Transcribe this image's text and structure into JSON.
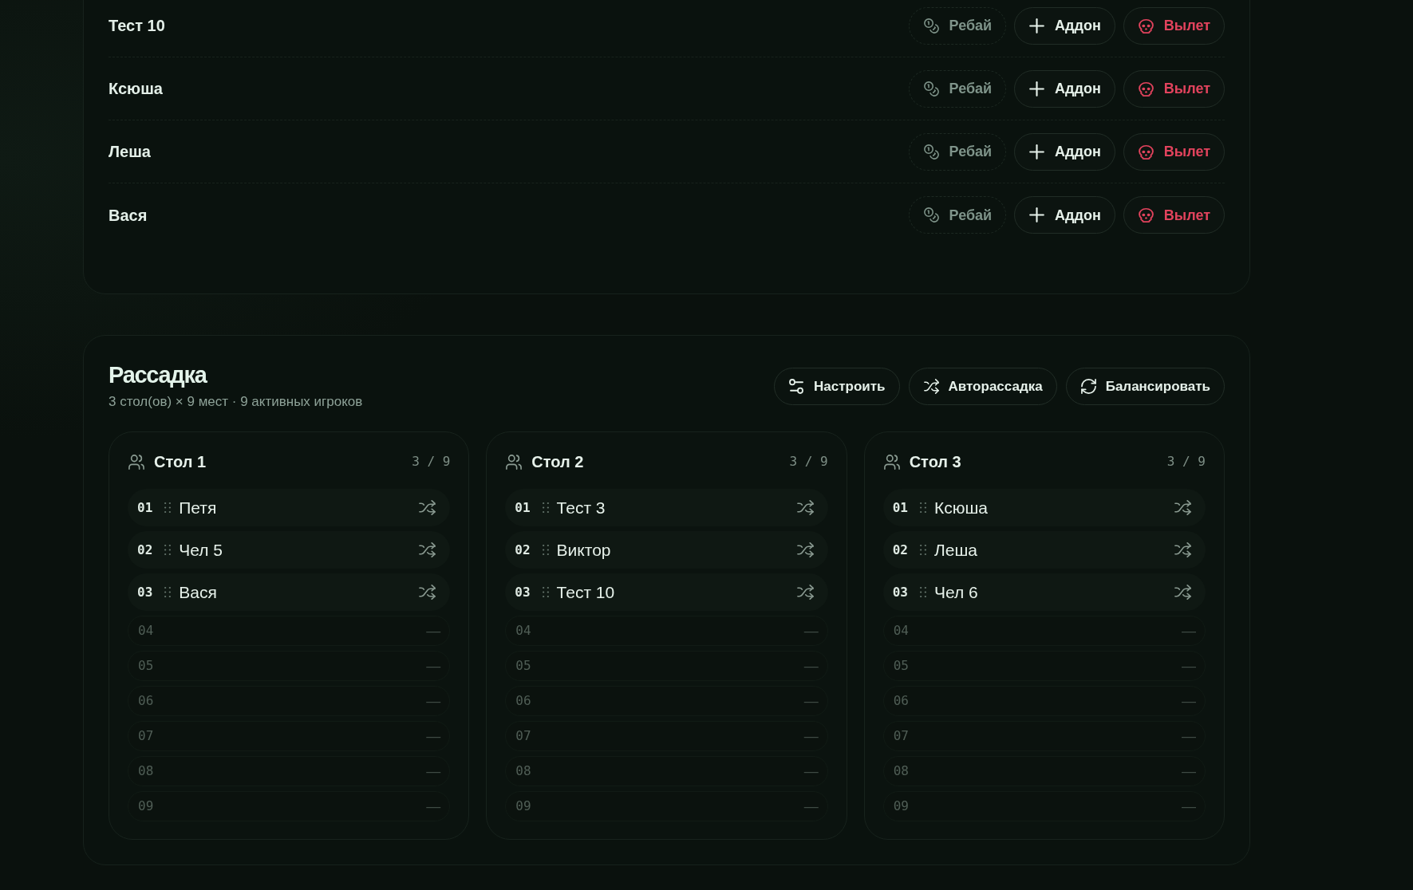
{
  "players": [
    {
      "name": "Тест 10",
      "actions": [
        {
          "label": "Ребай",
          "kind": "rebuy",
          "disabled": true
        },
        {
          "label": "Аддон",
          "kind": "addon",
          "disabled": false
        },
        {
          "label": "Вылет",
          "kind": "bust",
          "disabled": false
        }
      ]
    },
    {
      "name": "Ксюша",
      "actions": [
        {
          "label": "Ребай",
          "kind": "rebuy",
          "disabled": true
        },
        {
          "label": "Аддон",
          "kind": "addon",
          "disabled": false
        },
        {
          "label": "Вылет",
          "kind": "bust",
          "disabled": false
        }
      ]
    },
    {
      "name": "Леша",
      "actions": [
        {
          "label": "Ребай",
          "kind": "rebuy",
          "disabled": true
        },
        {
          "label": "Аддон",
          "kind": "addon",
          "disabled": false
        },
        {
          "label": "Вылет",
          "kind": "bust",
          "disabled": false
        }
      ]
    },
    {
      "name": "Вася",
      "actions": [
        {
          "label": "Ребай",
          "kind": "rebuy",
          "disabled": true
        },
        {
          "label": "Аддон",
          "kind": "addon",
          "disabled": false
        },
        {
          "label": "Вылет",
          "kind": "bust",
          "disabled": false
        }
      ]
    }
  ],
  "seating": {
    "title": "Рассадка",
    "subtitle": "3 стол(ов) × 9 мест · 9 активных игроков",
    "buttons": [
      {
        "label": "Настроить",
        "kind": "configure"
      },
      {
        "label": "Авторассадка",
        "kind": "autoseat"
      },
      {
        "label": "Балансировать",
        "kind": "balance"
      }
    ],
    "tables": [
      {
        "name": "Стол 1",
        "count": "3 / 9",
        "seats": [
          {
            "number": "01",
            "kind": "player",
            "name": "Петя"
          },
          {
            "number": "02",
            "kind": "player",
            "name": "Чел 5"
          },
          {
            "number": "03",
            "kind": "player",
            "name": "Вася"
          },
          {
            "number": "04",
            "kind": "empty",
            "name": "—"
          },
          {
            "number": "05",
            "kind": "empty",
            "name": "—"
          },
          {
            "number": "06",
            "kind": "empty",
            "name": "—"
          },
          {
            "number": "07",
            "kind": "empty",
            "name": "—"
          },
          {
            "number": "08",
            "kind": "empty",
            "name": "—"
          },
          {
            "number": "09",
            "kind": "empty",
            "name": "—"
          }
        ]
      },
      {
        "name": "Стол 2",
        "count": "3 / 9",
        "seats": [
          {
            "number": "01",
            "kind": "player",
            "name": "Тест 3"
          },
          {
            "number": "02",
            "kind": "player",
            "name": "Виктор"
          },
          {
            "number": "03",
            "kind": "player",
            "name": "Тест 10"
          },
          {
            "number": "04",
            "kind": "empty",
            "name": "—"
          },
          {
            "number": "05",
            "kind": "empty",
            "name": "—"
          },
          {
            "number": "06",
            "kind": "empty",
            "name": "—"
          },
          {
            "number": "07",
            "kind": "empty",
            "name": "—"
          },
          {
            "number": "08",
            "kind": "empty",
            "name": "—"
          },
          {
            "number": "09",
            "kind": "empty",
            "name": "—"
          }
        ]
      },
      {
        "name": "Стол 3",
        "count": "3 / 9",
        "seats": [
          {
            "number": "01",
            "kind": "player",
            "name": "Ксюша"
          },
          {
            "number": "02",
            "kind": "player",
            "name": "Леша"
          },
          {
            "number": "03",
            "kind": "player",
            "name": "Чел 6"
          },
          {
            "number": "04",
            "kind": "empty",
            "name": "—"
          },
          {
            "number": "05",
            "kind": "empty",
            "name": "—"
          },
          {
            "number": "06",
            "kind": "empty",
            "name": "—"
          },
          {
            "number": "07",
            "kind": "empty",
            "name": "—"
          },
          {
            "number": "08",
            "kind": "empty",
            "name": "—"
          },
          {
            "number": "09",
            "kind": "empty",
            "name": "—"
          }
        ]
      }
    ]
  }
}
